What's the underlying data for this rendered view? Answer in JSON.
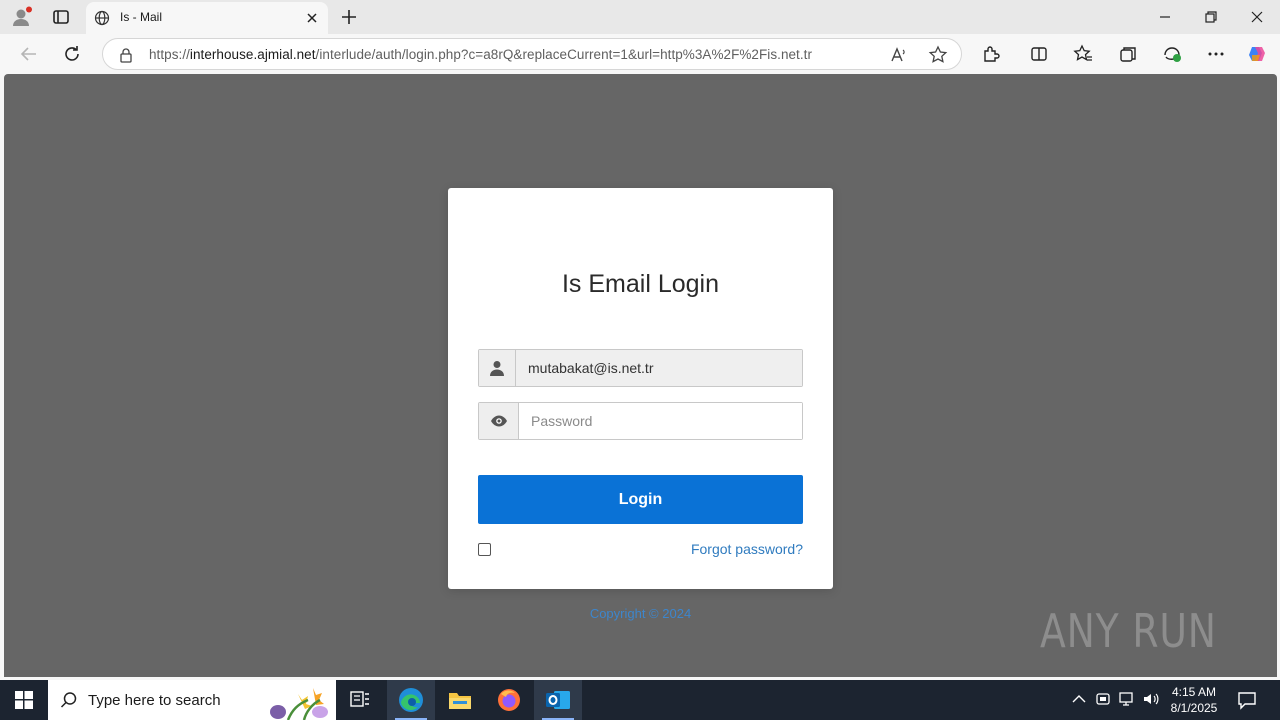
{
  "browser": {
    "tab_title": "Is - Mail",
    "url_prefix": "https://",
    "url_host": "interhouse.ajmial.net",
    "url_rest": "/interlude/auth/login.php?c=a8rQ&replaceCurrent=1&url=http%3A%2F%2Fis.net.tr",
    "icons": [
      "profile-icon",
      "tab-actions-icon",
      "globe-icon",
      "close-icon",
      "plus-icon",
      "minimize-icon",
      "restore-icon",
      "window-close-icon",
      "back-icon",
      "refresh-icon",
      "site-info-icon",
      "read-aloud-icon",
      "favorite-star-icon",
      "extensions-icon",
      "split-screen-icon",
      "favorites-icon",
      "collections-icon",
      "browser-essentials-icon",
      "more-icon",
      "copilot-icon"
    ]
  },
  "login": {
    "title": "Is Email Login",
    "email_value": "mutabakat@is.net.tr",
    "password_placeholder": "Password",
    "login_button": "Login",
    "forgot_link": "Forgot password?",
    "copyright": "Copyright © 2024"
  },
  "watermark": {
    "text": "ANY RUN"
  },
  "taskbar": {
    "search_placeholder": "Type here to search",
    "time": "4:15 AM",
    "date": "8/1/2025"
  },
  "colors": {
    "page_bg": "#666666",
    "login_button": "#0a72d6",
    "link": "#2f7bbf",
    "taskbar": "#1c2430"
  }
}
